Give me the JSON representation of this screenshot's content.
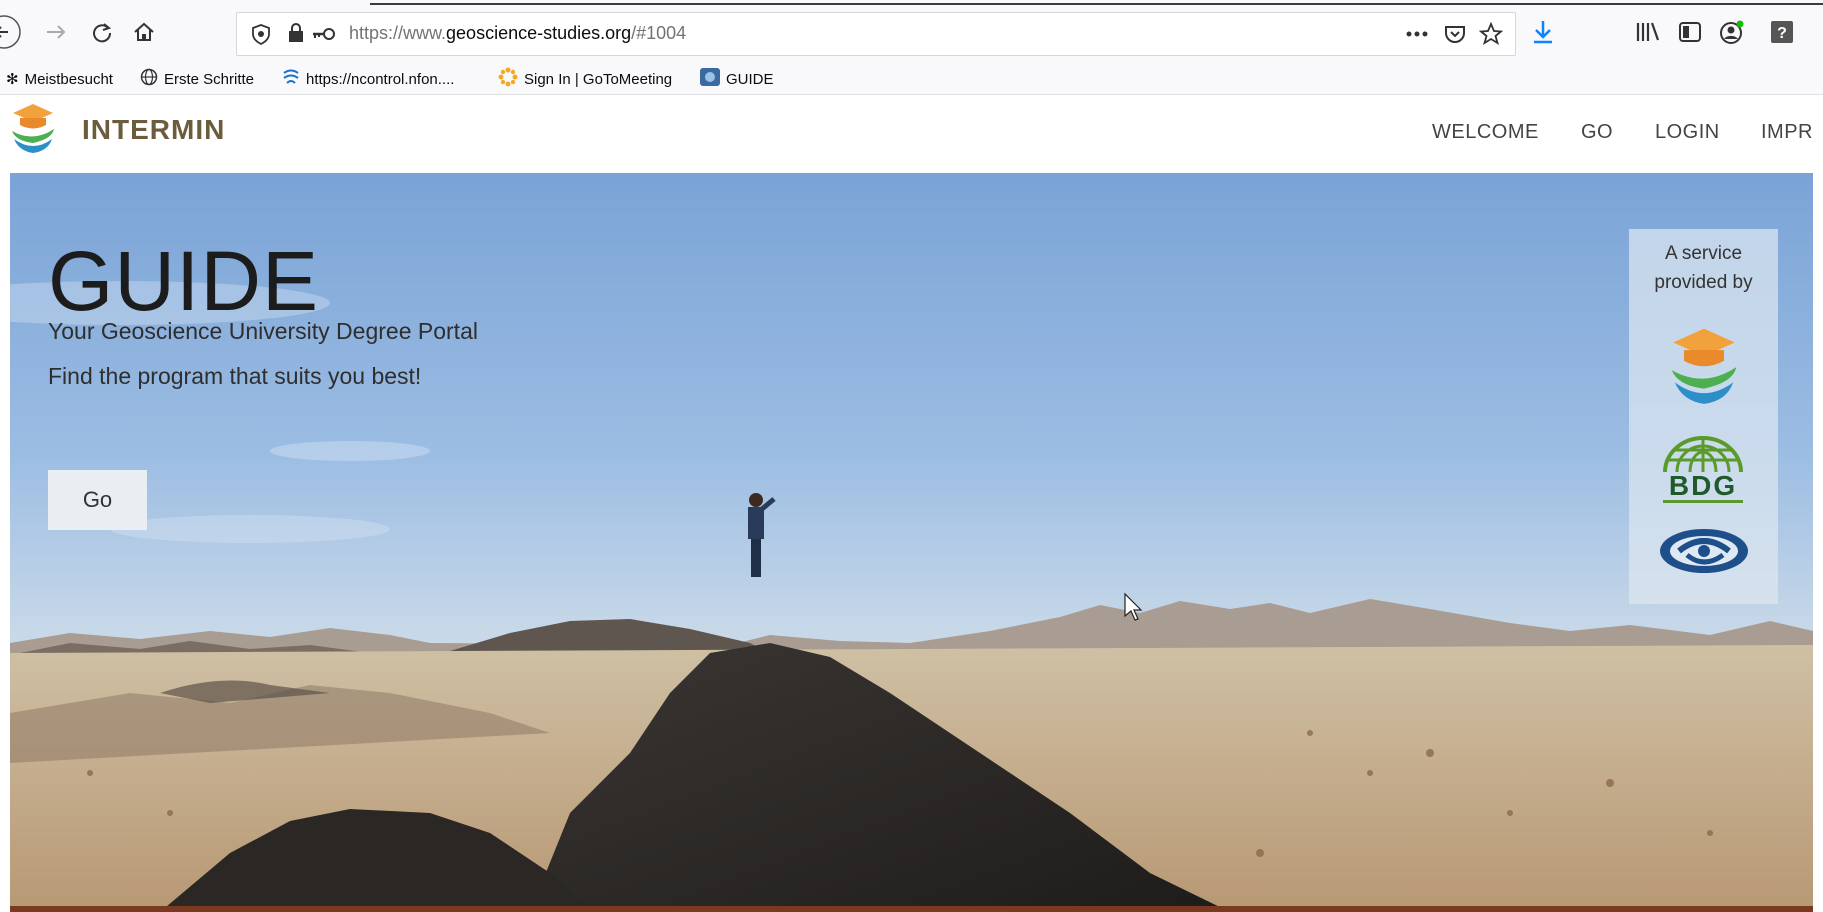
{
  "browser": {
    "url_prefix": "https://www.",
    "url_domain": "geoscience-studies.org",
    "url_suffix": "/#1004"
  },
  "bookmarks": [
    {
      "label": "Meistbesucht",
      "icon": "gear-icon"
    },
    {
      "label": "Erste Schritte",
      "icon": "globe-icon"
    },
    {
      "label": "https://ncontrol.nfon....",
      "icon": "nfon-icon"
    },
    {
      "label": "Sign In | GoToMeeting",
      "icon": "gotomeeting-icon"
    },
    {
      "label": "GUIDE",
      "icon": "guide-favicon"
    }
  ],
  "site": {
    "brand": "INTERMIN",
    "nav": [
      "WELCOME",
      "GO",
      "LOGIN",
      "IMPR"
    ]
  },
  "hero": {
    "title": "GUIDE",
    "subtitle_1": "Your Geoscience University Degree Portal",
    "subtitle_2": "Find the program that suits you best!",
    "button": "Go",
    "provider_line_1": "A service",
    "provider_line_2": "provided by",
    "provider_logo_2": "BDG"
  },
  "colors": {
    "brand_text": "#6b5c3e",
    "logo_orange": "#f2a23c",
    "logo_green": "#4caf50",
    "logo_blue": "#2d8fc9",
    "download_blue": "#0a84ff"
  }
}
